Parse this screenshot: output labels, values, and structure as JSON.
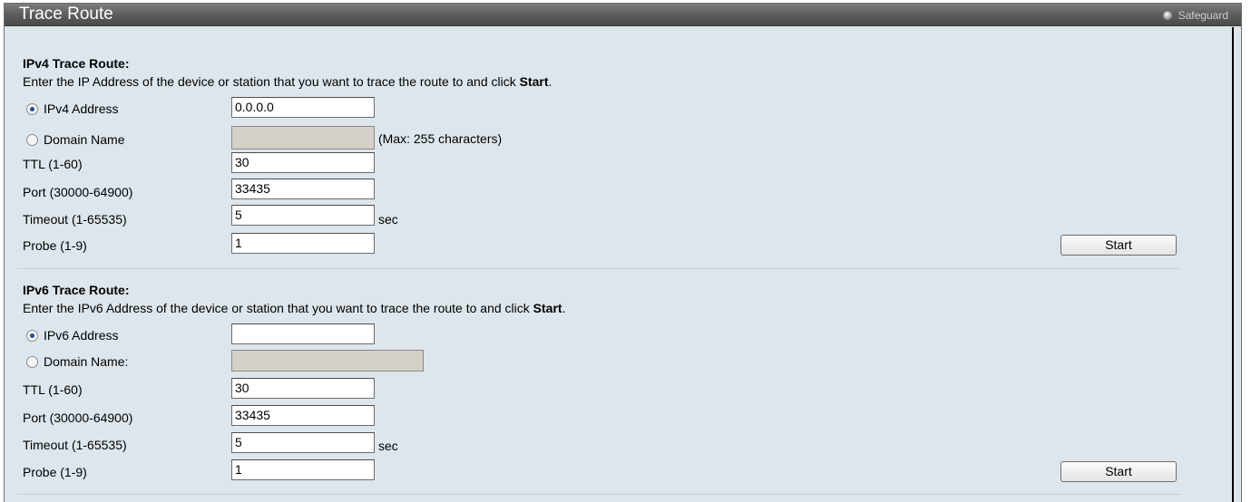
{
  "window": {
    "title": "Trace Route",
    "safeguard_label": "Safeguard"
  },
  "ipv4": {
    "section_title": "IPv4 Trace Route:",
    "description_prefix": "Enter the IP Address of the device or station that you want to trace the route to and click ",
    "description_bold": "Start",
    "description_suffix": ".",
    "ip_radio_label": "IPv4 Address",
    "ip_value": "0.0.0.0",
    "domain_radio_label": "Domain Name",
    "domain_value": "",
    "domain_hint": "(Max: 255 characters)",
    "ttl_label": "TTL (1-60)",
    "ttl_value": "30",
    "port_label": "Port (30000-64900)",
    "port_value": "33435",
    "timeout_label": "Timeout (1-65535)",
    "timeout_value": "5",
    "timeout_unit": "sec",
    "probe_label": "Probe (1-9)",
    "probe_value": "1",
    "start_label": "Start"
  },
  "ipv6": {
    "section_title": "IPv6 Trace Route:",
    "description_prefix": "Enter the IPv6 Address of the device or station that you want to trace the route to and click ",
    "description_bold": "Start",
    "description_suffix": ".",
    "ip_radio_label": "IPv6 Address",
    "ip_value": "",
    "domain_radio_label": "Domain Name:",
    "domain_value": "",
    "ttl_label": "TTL (1-60)",
    "ttl_value": "30",
    "port_label": "Port (30000-64900)",
    "port_value": "33435",
    "timeout_label": "Timeout (1-65535)",
    "timeout_value": "5",
    "timeout_unit": "sec",
    "probe_label": "Probe (1-9)",
    "probe_value": "1",
    "start_label": "Start"
  },
  "colors": {
    "panel_background": "#dde6ec",
    "titlebar": "#5a5a5a",
    "radio_selected": "#1f4e9b",
    "disabled_input": "#d4d0c8"
  }
}
